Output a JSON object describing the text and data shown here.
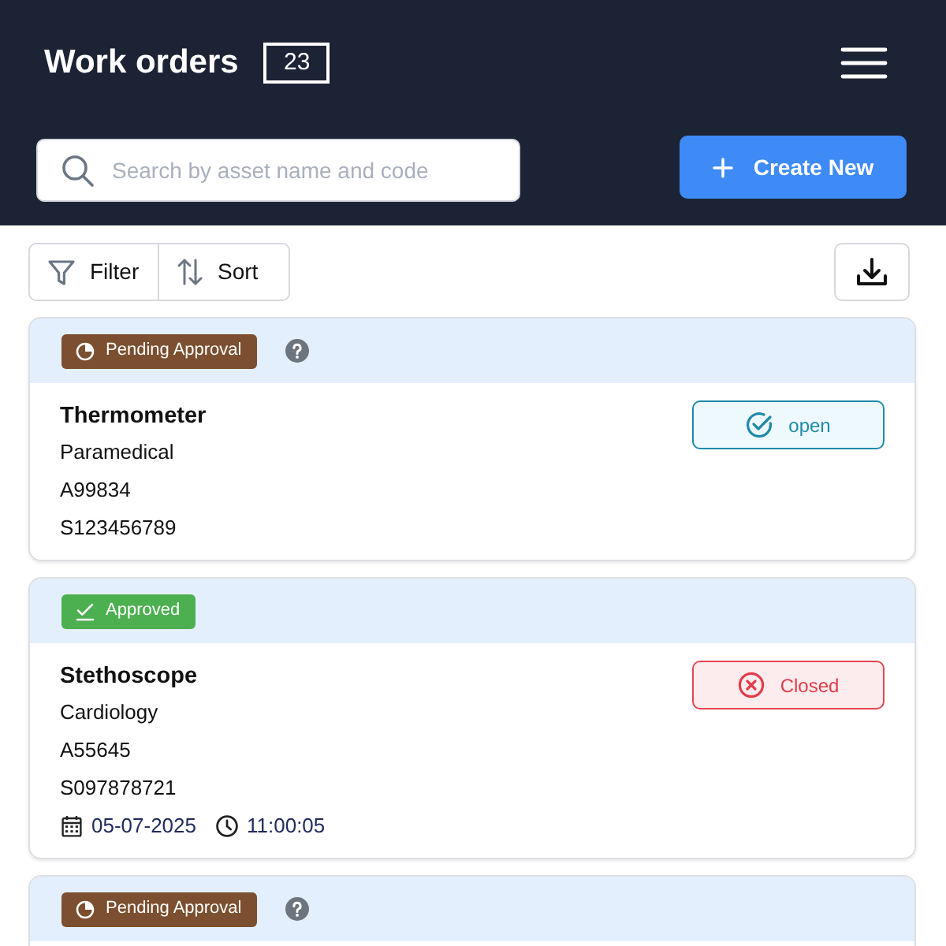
{
  "header": {
    "title": "Work orders",
    "count": "23"
  },
  "search": {
    "placeholder": "Search by asset name and code"
  },
  "create_button": {
    "label": "Create New"
  },
  "toolbar": {
    "filter": "Filter",
    "sort": "Sort"
  },
  "work_orders": [
    {
      "approval": {
        "kind": "pending",
        "label": "Pending Approval",
        "help": true
      },
      "name": "Thermometer",
      "department": "Paramedical",
      "asset_code": "A99834",
      "serial": "S123456789",
      "status": {
        "kind": "open",
        "label": "open"
      }
    },
    {
      "approval": {
        "kind": "approved",
        "label": "Approved",
        "help": false
      },
      "name": "Stethoscope",
      "department": "Cardiology",
      "asset_code": "A55645",
      "serial": "S097878721",
      "date": "05-07-2025",
      "time": "11:00:05",
      "status": {
        "kind": "closed",
        "label": "Closed"
      }
    },
    {
      "approval": {
        "kind": "pending",
        "label": "Pending Approval",
        "help": true
      }
    }
  ]
}
